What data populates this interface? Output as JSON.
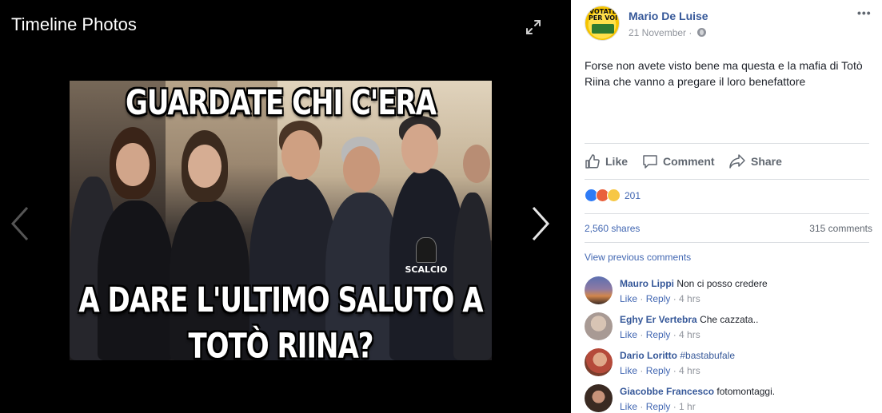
{
  "viewer": {
    "title": "Timeline Photos",
    "meme": {
      "top_text": "GUARDATE CHI C'ERA",
      "bottom_line1": "A DARE L'ULTIMO SALUTO A",
      "bottom_line2": "TOTÒ RIINA?",
      "watermark": "SCALCIO"
    }
  },
  "post": {
    "author": "Mario De Luise",
    "avatar_text": "VOTATE PER VOI",
    "date": "21 November",
    "date_separator": "·",
    "more": "•••",
    "text": "Forse non avete visto bene ma questa e la mafia di Totò Riina che vanno a pregare il loro benefattore",
    "actions": {
      "like": "Like",
      "comment": "Comment",
      "share": "Share"
    },
    "reactions_count": "201",
    "shares": "2,560 shares",
    "comments_count": "315 comments",
    "view_previous": "View previous comments"
  },
  "comments": [
    {
      "name": "Mauro Lippi",
      "text": "Non ci posso credere",
      "tag": "",
      "like": "Like",
      "reply": "Reply",
      "time": "4 hrs"
    },
    {
      "name": "Eghy Er Vertebra",
      "text": "Che cazzata..",
      "tag": "",
      "like": "Like",
      "reply": "Reply",
      "time": "4 hrs"
    },
    {
      "name": "Dario Loritto",
      "text": "",
      "tag": "#bastabufale",
      "like": "Like",
      "reply": "Reply",
      "time": "4 hrs"
    },
    {
      "name": "Giacobbe Francesco",
      "text": "fotomontaggi.",
      "tag": "",
      "like": "Like",
      "reply": "Reply",
      "time": "1 hr"
    }
  ],
  "colors": {
    "link": "#365899",
    "secondary_link": "#4267b2",
    "muted": "#90949c",
    "viewer_bg": "#000000"
  }
}
